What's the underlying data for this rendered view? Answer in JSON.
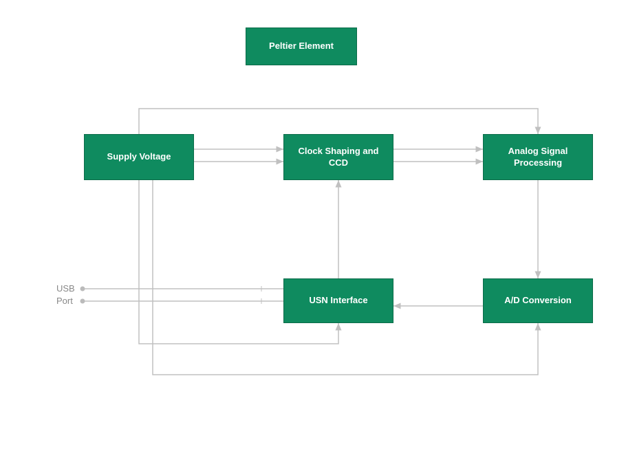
{
  "blocks": {
    "peltier": "Peltier Element",
    "supply": "Supply Voltage",
    "clock": "Clock Shaping and CCD",
    "analog": "Analog Signal Processing",
    "usn": "USN Interface",
    "ad": "A/D Conversion"
  },
  "labels": {
    "usb": "USB",
    "port": "Port"
  },
  "colors": {
    "block_bg": "#0f8b5f",
    "block_border": "#0a6b48",
    "text": "#ffffff",
    "connector": "#c0c0c0",
    "label": "#888888"
  }
}
